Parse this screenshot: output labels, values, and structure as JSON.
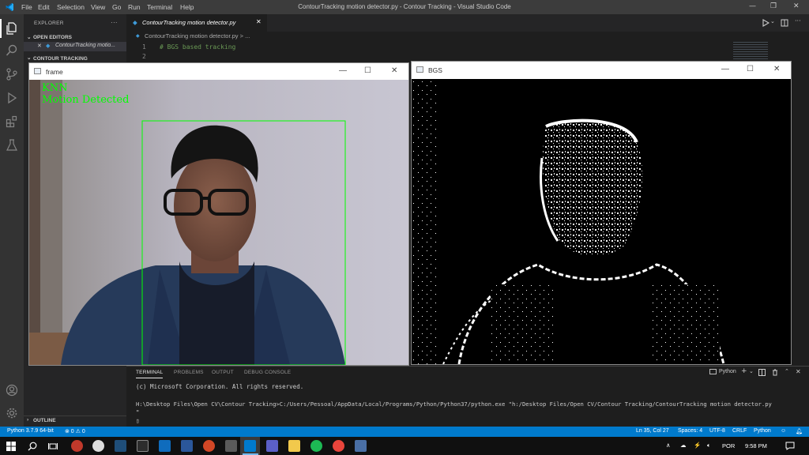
{
  "titlebar": {
    "menu": [
      "File",
      "Edit",
      "Selection",
      "View",
      "Go",
      "Run",
      "Terminal",
      "Help"
    ],
    "title": "ContourTracking motion detector.py - Contour Tracking - Visual Studio Code"
  },
  "sidebar": {
    "header": "EXPLORER",
    "more": "···",
    "open_editors": "OPEN EDITORS",
    "open_file": "ContourTracking motio...",
    "close_glyph": "✕",
    "folder": "CONTOUR TRACKING",
    "outline": "OUTLINE"
  },
  "editor": {
    "tab_label": "ContourTracking motion detector.py",
    "breadcrumb": "ContourTracking motion detector.py > ...",
    "lines": [
      {
        "n": "1",
        "code": "# BGS based tracking"
      },
      {
        "n": "2",
        "code": ""
      }
    ]
  },
  "frame_window": {
    "title": "frame",
    "overlay_line1": "KNN",
    "overlay_line2": "Motion Detected",
    "overlay_color": "#00ff00"
  },
  "bgs_window": {
    "title": "BGS"
  },
  "panel": {
    "tabs": [
      "TERMINAL",
      "PROBLEMS",
      "OUTPUT",
      "DEBUG CONSOLE"
    ],
    "terminal_selector": "Python",
    "lines": [
      "(c) Microsoft Corporation. All rights reserved.",
      "",
      "H:\\Desktop Files\\Open CV\\Contour Tracking>C:/Users/Pessoal/AppData/Local/Programs/Python/Python37/python.exe \"h:/Desktop Files/Open CV/Contour Tracking/ContourTracking motion detector.py",
      "\""
    ],
    "cursor": "▯"
  },
  "statusbar": {
    "interpreter": "Python 3.7.9 64-bit",
    "problems": "⊗ 0 ⚠ 0",
    "position": "Ln 35, Col 27",
    "spaces": "Spaces: 4",
    "encoding": "UTF-8",
    "eol": "CRLF",
    "language": "Python"
  },
  "taskbar": {
    "lang": "POR",
    "time": "9:58 PM"
  },
  "colors": {
    "accent": "#007acc",
    "titlebar": "#3c3c3c",
    "activitybar": "#333333",
    "sidebar": "#252526",
    "editor": "#1e1e1e"
  }
}
